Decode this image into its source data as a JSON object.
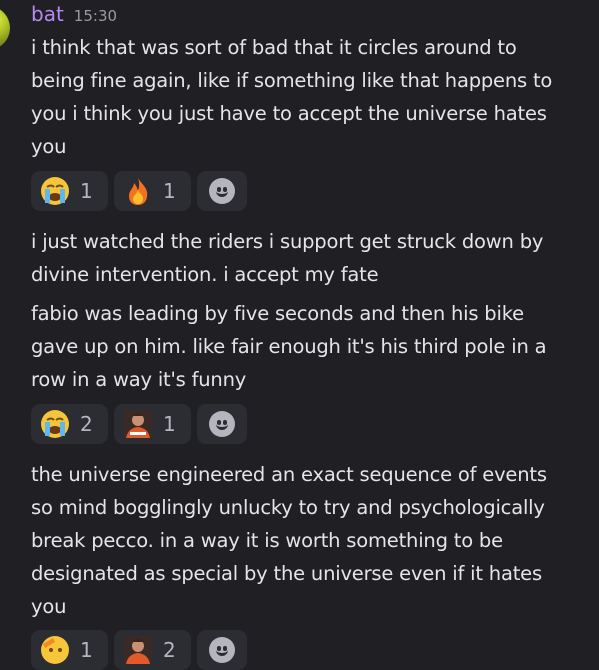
{
  "author": {
    "name": "bat",
    "time": "15:30"
  },
  "messages": [
    {
      "lines": [
        "i think that was sort of bad that it circles around to",
        "being fine again, like if something like that happens to",
        "you i think you just have to accept the universe hates",
        "you"
      ]
    },
    {
      "lines": [
        "i just watched the riders i support get struck down by",
        "divine intervention. i accept my fate"
      ]
    },
    {
      "lines": [
        "fabio was leading by five seconds and then his bike",
        "gave up on him. like fair enough it's his third pole in a",
        "row in a way it's funny"
      ]
    },
    {
      "lines": [
        "the universe engineered an exact sequence of events",
        "so mind bogglingly unlucky to try and psychologically",
        "break pecco. in a way it is worth something to be",
        "designated as special by the universe even if it hates",
        "you"
      ]
    }
  ],
  "reactions": {
    "r1": [
      {
        "emoji": "loudly-crying-face",
        "count": "1"
      },
      {
        "emoji": "fire",
        "count": "1"
      }
    ],
    "r2": [
      {
        "emoji": "loudly-crying-face",
        "count": "2"
      },
      {
        "emoji": "rider-custom-emoji",
        "count": "1"
      }
    ],
    "r3": [
      {
        "emoji": "saluting-face",
        "count": "1"
      },
      {
        "emoji": "rider-custom-emoji",
        "count": "2"
      }
    ]
  },
  "colors": {
    "background": "#1f1f24",
    "username": "#b889f4",
    "reaction_bg": "#2c2c33"
  }
}
